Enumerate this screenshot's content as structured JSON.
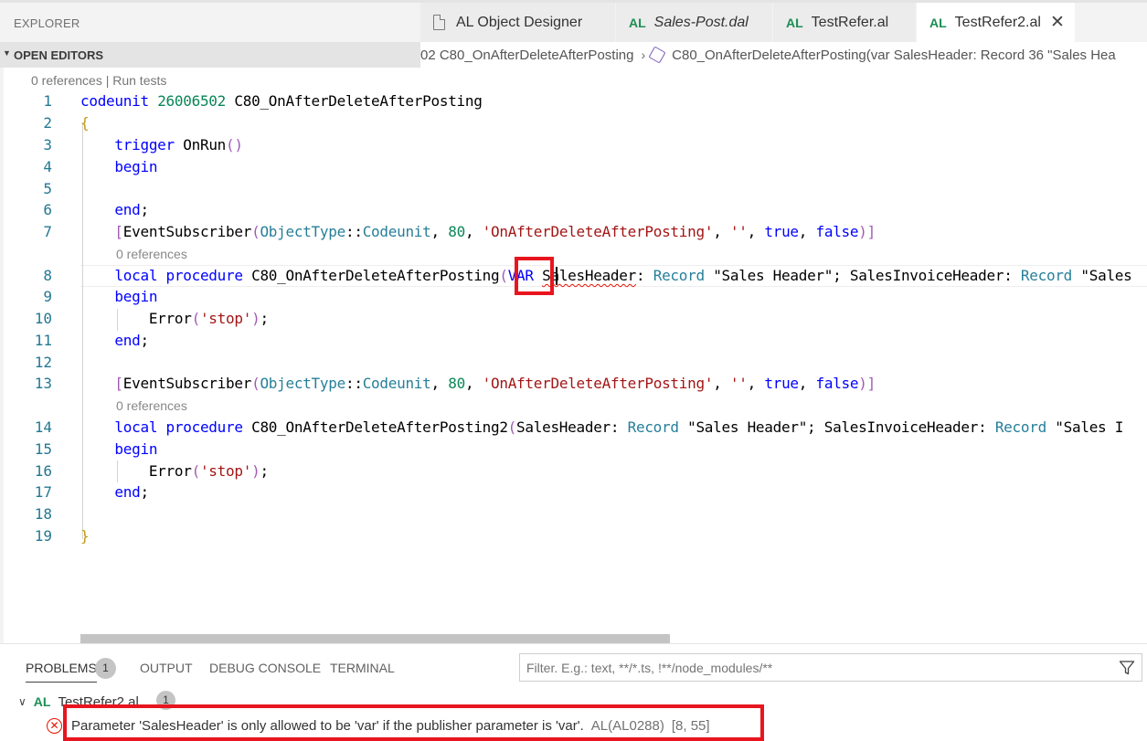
{
  "sidebar": {
    "title": "EXPLORER",
    "open_editors": "OPEN EDITORS"
  },
  "tabs": [
    {
      "label": "AL Object Designer",
      "icon": "file-icon",
      "italic": false,
      "active": false
    },
    {
      "label": "Sales-Post.dal",
      "icon": "AL",
      "italic": true,
      "active": false
    },
    {
      "label": "TestRefer.al",
      "icon": "AL",
      "italic": false,
      "active": false
    },
    {
      "label": "TestRefer2.al",
      "icon": "AL",
      "italic": false,
      "active": true
    }
  ],
  "tab_close": "✕",
  "breadcrumb": {
    "first": "02 C80_OnAfterDeleteAfterPosting",
    "second": "C80_OnAfterDeleteAfterPosting(var SalesHeader: Record 36 \"Sales Hea"
  },
  "editor": {
    "ghost_text": "0 references | Run tests",
    "codelens": [
      "0 references",
      "0 references"
    ],
    "line_numbers": [
      "1",
      "2",
      "3",
      "4",
      "5",
      "6",
      "7",
      "8",
      "9",
      "10",
      "11",
      "12",
      "13",
      "14",
      "15",
      "16",
      "17",
      "18",
      "19"
    ],
    "lines": [
      "codeunit 26006502 C80_OnAfterDeleteAfterPosting",
      "{",
      "    trigger OnRun()",
      "    begin",
      "",
      "    end;",
      "    [EventSubscriber(ObjectType::Codeunit, 80, 'OnAfterDeleteAfterPosting', '', true, false)]",
      "    local procedure C80_OnAfterDeleteAfterPosting(VAR SalesHeader: Record \"Sales Header\"; SalesInvoiceHeader: Record \"Sales",
      "    begin",
      "        Error('stop');",
      "    end;",
      "",
      "    [EventSubscriber(ObjectType::Codeunit, 80, 'OnAfterDeleteAfterPosting', '', true, false)]",
      "    local procedure C80_OnAfterDeleteAfterPosting2(SalesHeader: Record \"Sales Header\"; SalesInvoiceHeader: Record \"Sales I",
      "    begin",
      "        Error('stop');",
      "    end;",
      "",
      "}"
    ]
  },
  "panel": {
    "tabs": [
      "PROBLEMS",
      "OUTPUT",
      "DEBUG CONSOLE",
      "TERMINAL"
    ],
    "problems_count": "1",
    "filter_placeholder": "Filter. E.g.: text, **/*.ts, !**/node_modules/**",
    "file_icon": "AL",
    "file_name": "TestRefer2.al",
    "file_count": "1",
    "error_message": "Parameter 'SalesHeader' is only allowed to be 'var' if the publisher parameter is 'var'.",
    "error_code": "AL(AL0288)",
    "error_position": "[8, 55]"
  },
  "colors": {
    "keyword": "#0000ff",
    "type": "#267f99",
    "string": "#a31515",
    "number": "#098658",
    "line_number": "#237893",
    "highlight_box": "#e8151e",
    "al_icon": "#1b8e55"
  }
}
